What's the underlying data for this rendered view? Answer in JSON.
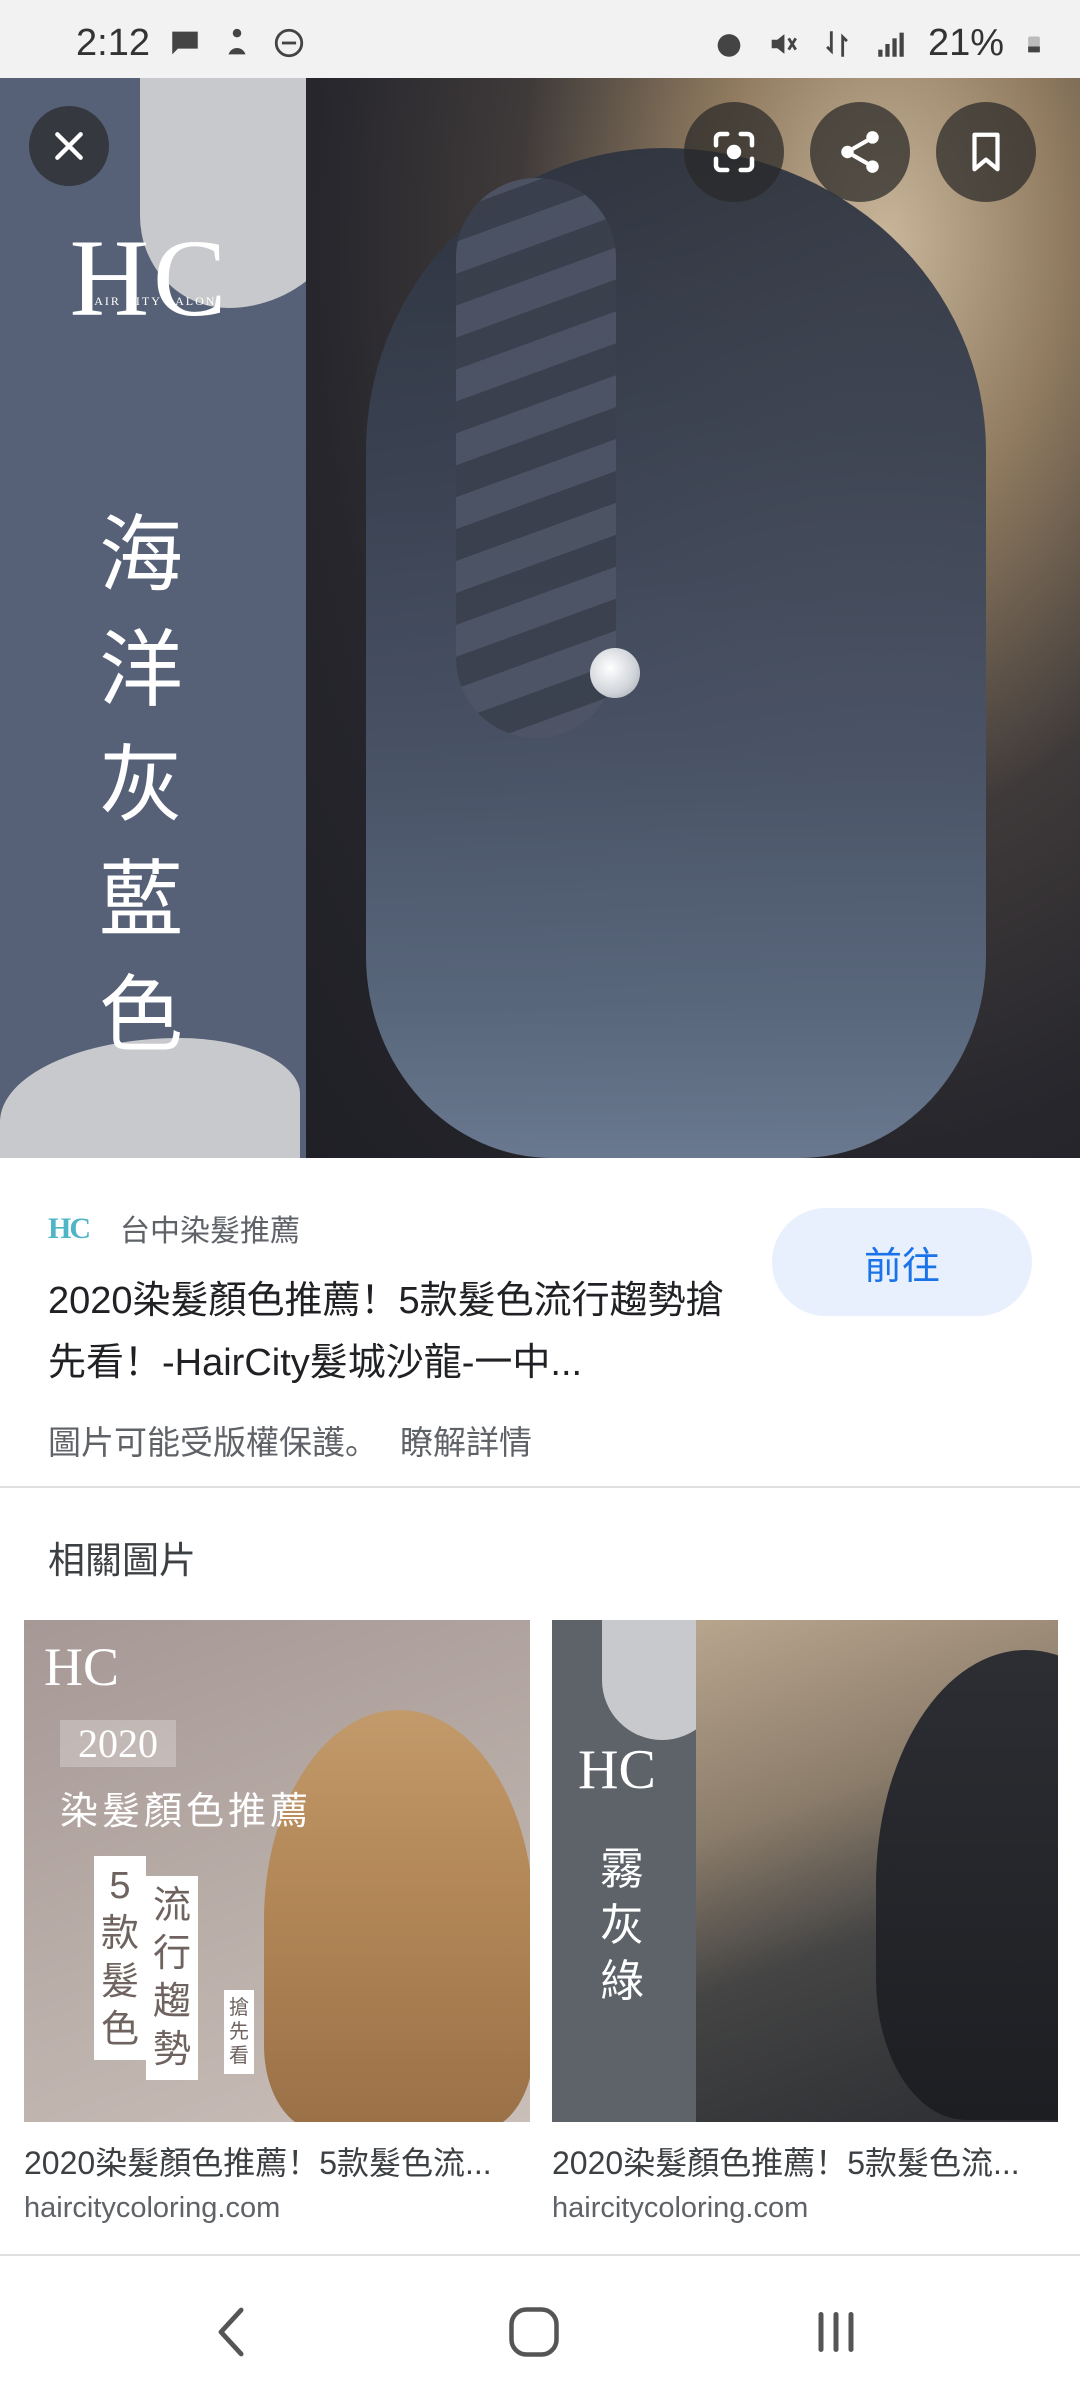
{
  "status_bar": {
    "time": "2:12",
    "battery": "21%"
  },
  "hero": {
    "brand": "HC",
    "brand_tagline": "HAIR CITY SALON",
    "vertical_text": [
      "海",
      "洋",
      "灰",
      "藍",
      "色"
    ]
  },
  "result": {
    "site_name": "台中染髮推薦",
    "title": "2020染髮顏色推薦！5款髮色流行趨勢搶先看！-HairCity髮城沙龍-一中...",
    "go_button": "前往",
    "copyright_notice": "圖片可能受版權保護。",
    "learn_more": "瞭解詳情"
  },
  "related": {
    "heading": "相關圖片",
    "items": [
      {
        "caption": "2020染髮顏色推薦！5款髮色流...",
        "domain": "haircitycoloring.com",
        "art_brand": "HC",
        "art_year": "2020",
        "art_sub": "染髮顏色推薦",
        "art_v1": "5款髮色",
        "art_v2": "流行趨勢",
        "art_v3": "搶先看"
      },
      {
        "caption": "2020染髮顏色推薦！5款髮色流...",
        "domain": "haircitycoloring.com",
        "art_brand": "HC",
        "art_vertical": "霧灰綠"
      }
    ]
  },
  "colors": {
    "accent": "#1a73e8",
    "button_bg": "#e8f0fe",
    "panel": "#566077"
  }
}
